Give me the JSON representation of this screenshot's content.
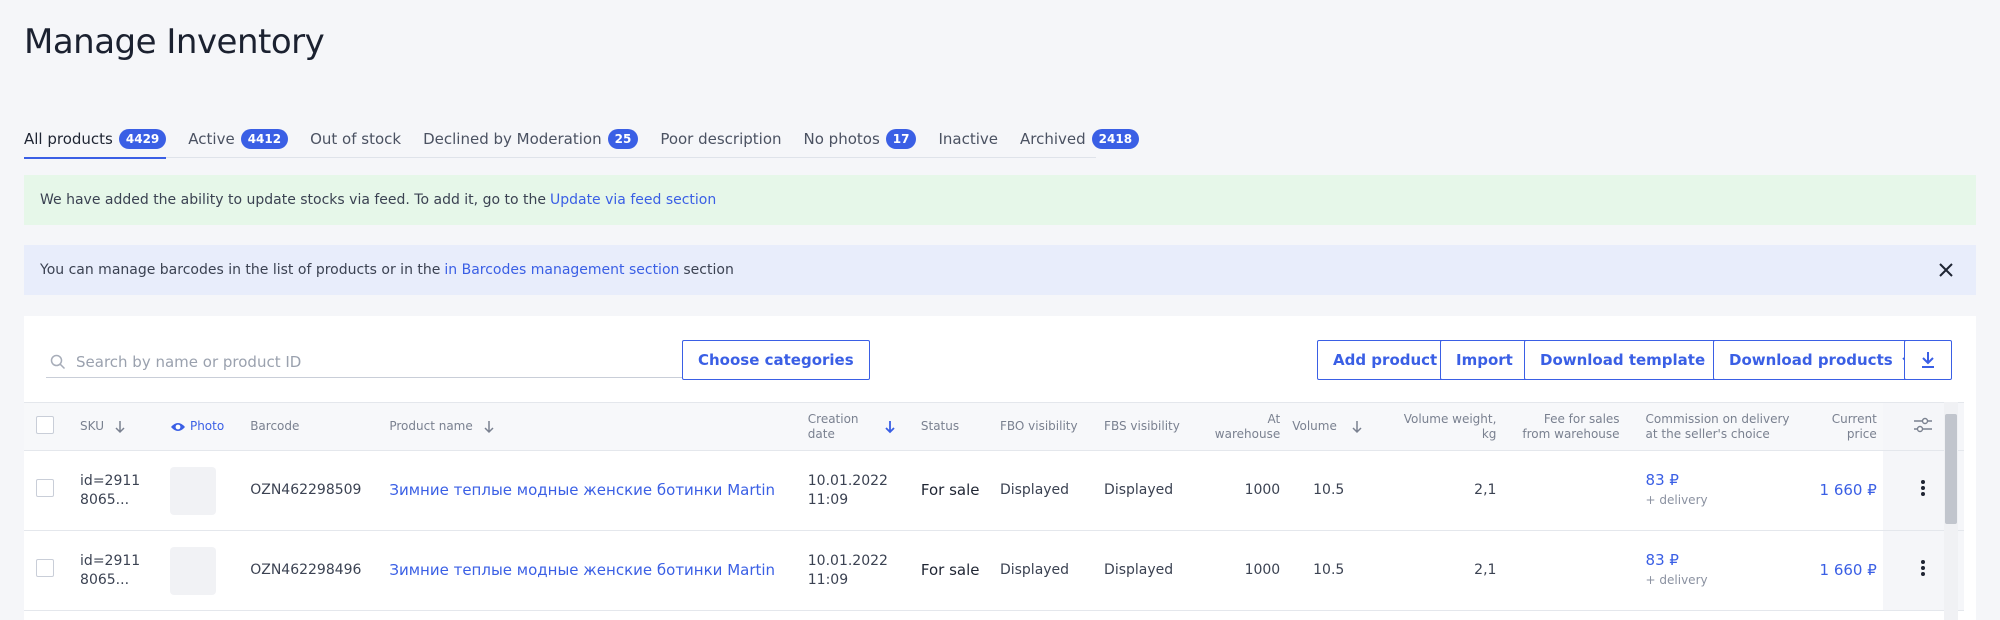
{
  "page": {
    "title": "Manage Inventory"
  },
  "tabs": [
    {
      "label": "All products",
      "badge": "4429",
      "active": true
    },
    {
      "label": "Active",
      "badge": "4412"
    },
    {
      "label": "Out of stock",
      "badge": null
    },
    {
      "label": "Declined by Moderation",
      "badge": "25"
    },
    {
      "label": "Poor description",
      "badge": null
    },
    {
      "label": "No photos",
      "badge": "17"
    },
    {
      "label": "Inactive",
      "badge": null
    },
    {
      "label": "Archived",
      "badge": "2418"
    }
  ],
  "alerts": {
    "feed": {
      "text": "We have added the ability to update stocks via feed. To add it, go to the",
      "link": "Update via feed section"
    },
    "barcodes": {
      "text": "You can manage barcodes in the list of products or in the",
      "link": "in Barcodes management section",
      "suffix": "section"
    }
  },
  "toolbar": {
    "search_placeholder": "Search by name or product ID",
    "choose_categories": "Choose categories",
    "add_product": "Add product",
    "import": "Import",
    "download_template": "Download template",
    "download_products": "Download products"
  },
  "table": {
    "headers": {
      "sku": "SKU",
      "photo": "Photo",
      "barcode": "Barcode",
      "product_name": "Product name",
      "creation_date_1": "Creation",
      "creation_date_2": "date",
      "status": "Status",
      "fbo": "FBO visibility",
      "fbs": "FBS visibility",
      "warehouse_1": "At",
      "warehouse_2": "warehouse",
      "volume": "Volume",
      "volume_weight_1": "Volume weight,",
      "volume_weight_2": "kg",
      "fee_1": "Fee for sales",
      "fee_2": "from warehouse",
      "commission_1": "Commission on delivery",
      "commission_2": "at the seller's choice",
      "price": "Current price"
    },
    "rows": [
      {
        "sku_1": "id=2911",
        "sku_2": "8065...",
        "barcode": "OZN462298509",
        "name": "Зимние теплые модные женские ботинки Martin",
        "date_1": "10.01.2022",
        "date_2": "11:09",
        "status": "For sale",
        "fbo": "Displayed",
        "fbs": "Displayed",
        "warehouse": "1000",
        "volume": "10.5",
        "volume_weight": "2,1",
        "fee": "",
        "commission": "83 ₽",
        "commission_note": "+ delivery",
        "price": "1 660 ₽"
      },
      {
        "sku_1": "id=2911",
        "sku_2": "8065...",
        "barcode": "OZN462298496",
        "name": "Зимние теплые модные женские ботинки Martin",
        "date_1": "10.01.2022",
        "date_2": "11:09",
        "status": "For sale",
        "fbo": "Displayed",
        "fbs": "Displayed",
        "warehouse": "1000",
        "volume": "10.5",
        "volume_weight": "2,1",
        "fee": "",
        "commission": "83 ₽",
        "commission_note": "+ delivery",
        "price": "1 660 ₽"
      }
    ]
  },
  "colors": {
    "accent": "#3a5fe5",
    "green_alert": "#e6f7e9",
    "blue_alert": "#e8edfb"
  },
  "icons": [
    "search-icon",
    "close-icon",
    "chevron-down-icon",
    "download-icon",
    "eye-icon",
    "sort-down-icon",
    "settings-sliders-icon",
    "kebab-menu-icon"
  ]
}
